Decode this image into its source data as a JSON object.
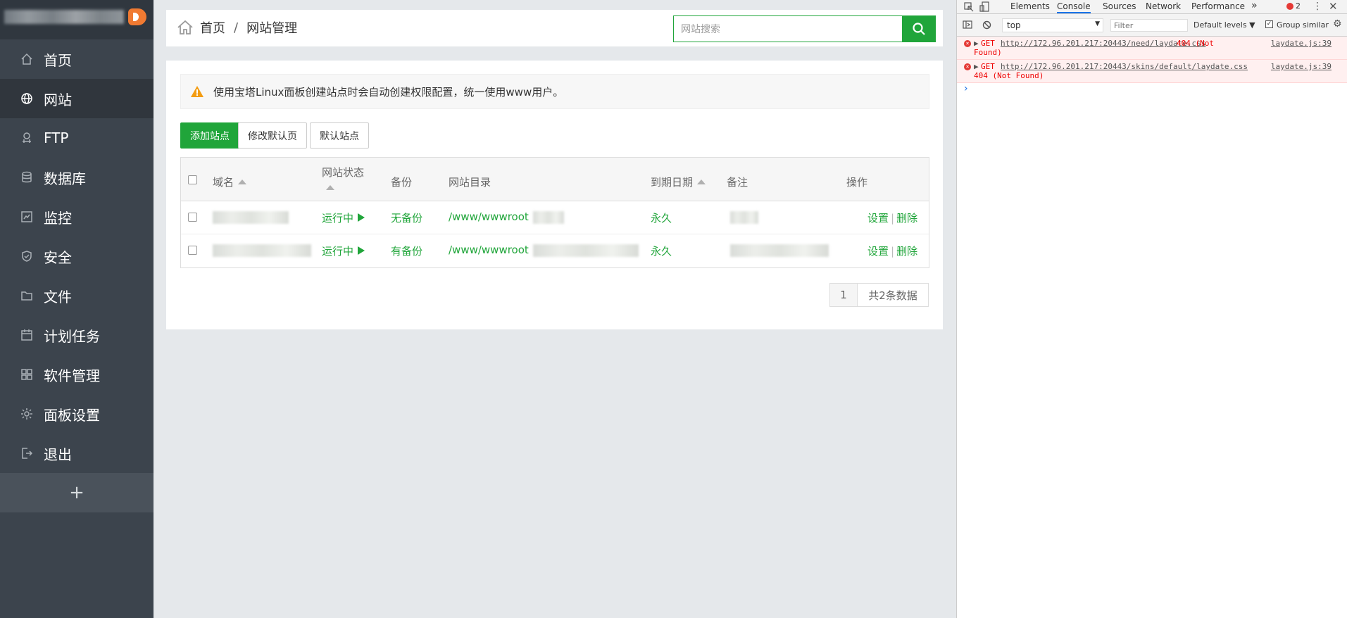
{
  "sidebar": {
    "items": [
      {
        "label": "首页",
        "icon": "home-icon"
      },
      {
        "label": "网站",
        "icon": "globe-icon"
      },
      {
        "label": "FTP",
        "icon": "ftp-icon"
      },
      {
        "label": "数据库",
        "icon": "database-icon"
      },
      {
        "label": "监控",
        "icon": "monitor-icon"
      },
      {
        "label": "安全",
        "icon": "shield-icon"
      },
      {
        "label": "文件",
        "icon": "folder-icon"
      },
      {
        "label": "计划任务",
        "icon": "calendar-icon"
      },
      {
        "label": "软件管理",
        "icon": "grid-icon"
      },
      {
        "label": "面板设置",
        "icon": "gear-icon"
      },
      {
        "label": "退出",
        "icon": "logout-icon"
      }
    ],
    "plus": "+"
  },
  "breadcrumb": {
    "home": "首页",
    "separator": "/",
    "current": "网站管理"
  },
  "search": {
    "placeholder": "网站搜索"
  },
  "notice": {
    "text": "使用宝塔Linux面板创建站点时会自动创建权限配置，统一使用www用户。"
  },
  "buttons": {
    "add_site": "添加站点",
    "modify_default_page": "修改默认页",
    "default_site": "默认站点"
  },
  "table": {
    "headers": {
      "domain": "域名",
      "status": "网站状态",
      "backup": "备份",
      "dir": "网站目录",
      "expire": "到期日期",
      "remark": "备注",
      "ops": "操作"
    },
    "rows": [
      {
        "status": "运行中",
        "backup": "无备份",
        "dir": "/www/wwwroot",
        "expire": "永久",
        "op_set": "设置",
        "op_sep": "|",
        "op_del": "删除"
      },
      {
        "status": "运行中",
        "backup": "有备份",
        "dir": "/www/wwwroot",
        "expire": "永久",
        "op_set": "设置",
        "op_sep": "|",
        "op_del": "删除"
      }
    ]
  },
  "pager": {
    "page": "1",
    "total": "共2条数据"
  },
  "devtools": {
    "tabs": [
      "Elements",
      "Console",
      "Sources",
      "Network",
      "Performance"
    ],
    "more": "»",
    "error_count": "2",
    "context": "top",
    "filter_placeholder": "Filter",
    "levels": "Default levels",
    "group_similar": "Group similar",
    "errors": [
      {
        "method": "GET",
        "url": "http://172.96.201.217:20443/need/laydate.css",
        "status_1": "404 (Not",
        "status_2": "Found)",
        "source": "laydate.js:39"
      },
      {
        "method": "GET",
        "url": "http://172.96.201.217:20443/skins/default/laydate.css",
        "status_2": "404 (Not Found)",
        "source": "laydate.js:39"
      }
    ],
    "prompt": "›"
  },
  "colors": {
    "accent": "#20a53a",
    "sidebar": "#3c444d",
    "error": "#e53935"
  }
}
